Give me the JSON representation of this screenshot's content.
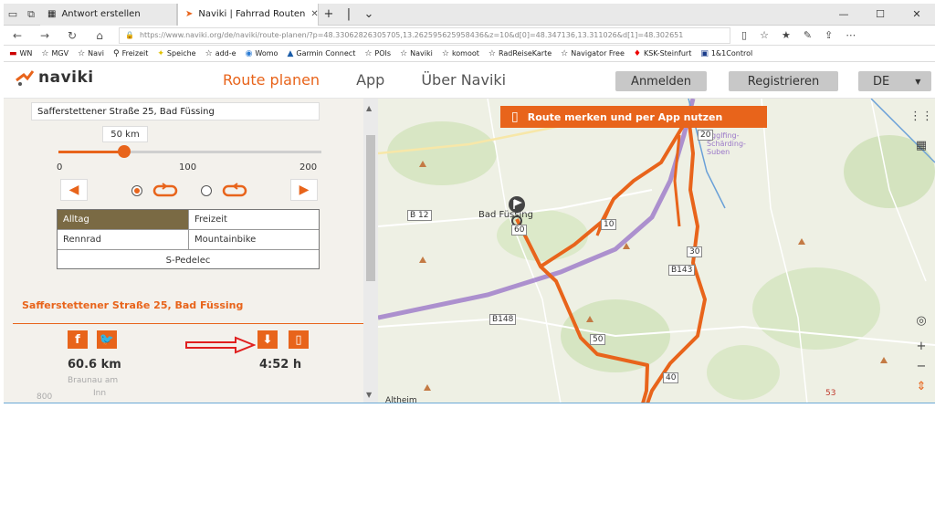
{
  "browser": {
    "tabs": [
      {
        "label": "Antwort erstellen",
        "active": false
      },
      {
        "label": "Naviki | Fahrrad Routen",
        "active": true
      }
    ],
    "url": "https://www.naviki.org/de/naviki/route-planen/?p=48.33062826305705,13.262595625958436&z=10&d[0]=48.347136,13.311026&d[1]=48.302651",
    "favorites": [
      "WN",
      "MGV",
      "Navi",
      "Freizeit",
      "Speiche",
      "add-e",
      "Womo",
      "Garmin Connect",
      "POIs",
      "Naviki",
      "komoot",
      "RadReiseKarte",
      "Navigator Free",
      "KSK-Steinfurt",
      "1&1Control"
    ]
  },
  "site": {
    "logo_text": "naviki",
    "nav": [
      "Route planen",
      "App",
      "Über Naviki"
    ],
    "login_label": "Anmelden",
    "register_label": "Registrieren",
    "language": "DE"
  },
  "planner": {
    "address": "Safferstettener Straße 25, Bad Füssing",
    "slider_value_label": "50 km",
    "slider_value": 50,
    "slider_max": 200,
    "ticks": [
      "0",
      "100",
      "200"
    ],
    "modes": [
      "Alltag",
      "Freizeit",
      "Rennrad",
      "Mountainbike",
      "S-Pedelec"
    ],
    "selected_mode": "Alltag",
    "place_title": "Safferstettener Straße 25, Bad Füssing",
    "distance": "60.6 km",
    "duration": "4:52 h",
    "faded_labels": [
      "Braunau am",
      "Inn",
      "800"
    ]
  },
  "map": {
    "banner": "Route merken und per App nutzen",
    "places": [
      "Bad Füssing",
      "Altheim",
      "Egglfing-\nSchärding-\nSuben"
    ],
    "roads": [
      "B 12",
      "B148",
      "B143",
      "10",
      "60",
      "50",
      "40",
      "30",
      "20",
      "53"
    ],
    "colors": {
      "route": "#e8641b",
      "river": "#9b78c8",
      "accent": "#e8641b"
    }
  }
}
